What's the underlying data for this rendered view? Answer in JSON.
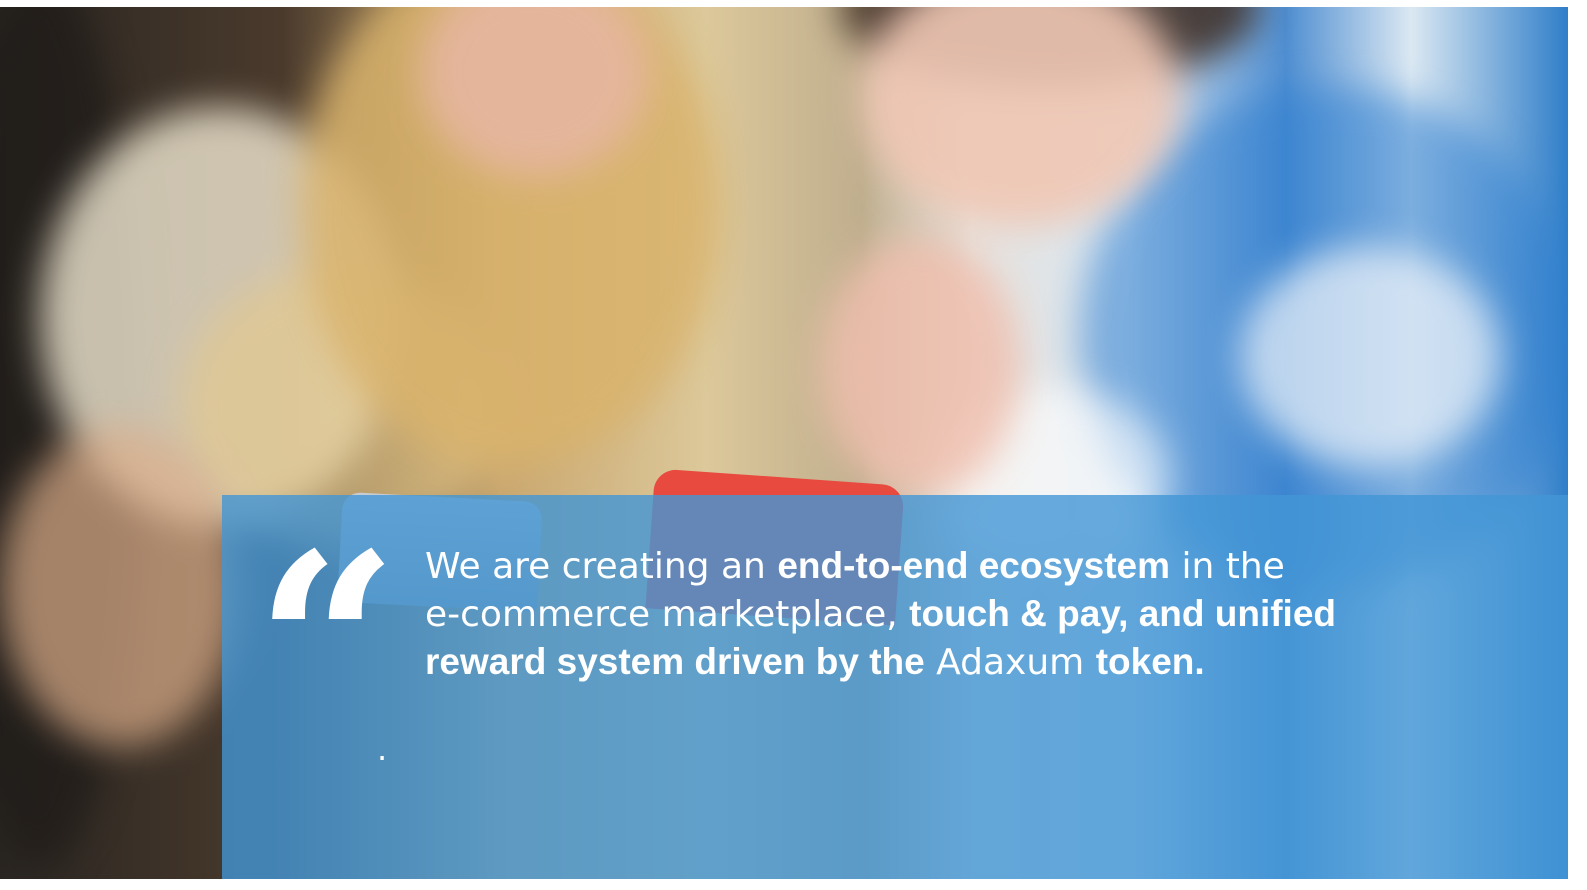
{
  "quote": {
    "mark": "“",
    "line1": {
      "part1": "We are creating an ",
      "bold1": "end-to-end ecosystem",
      "part2": " in the"
    },
    "line2": {
      "part1": "e-commerce marketplace, ",
      "bold1": "touch & pay, and unified"
    },
    "line3": {
      "bold1": "reward system driven by the",
      "part1": " Adaxum ",
      "bold2": "token."
    },
    "dot": "."
  },
  "colors": {
    "overlay": "#4296D6",
    "text": "#FFFFFF",
    "phone_red": "#E84A3F"
  }
}
